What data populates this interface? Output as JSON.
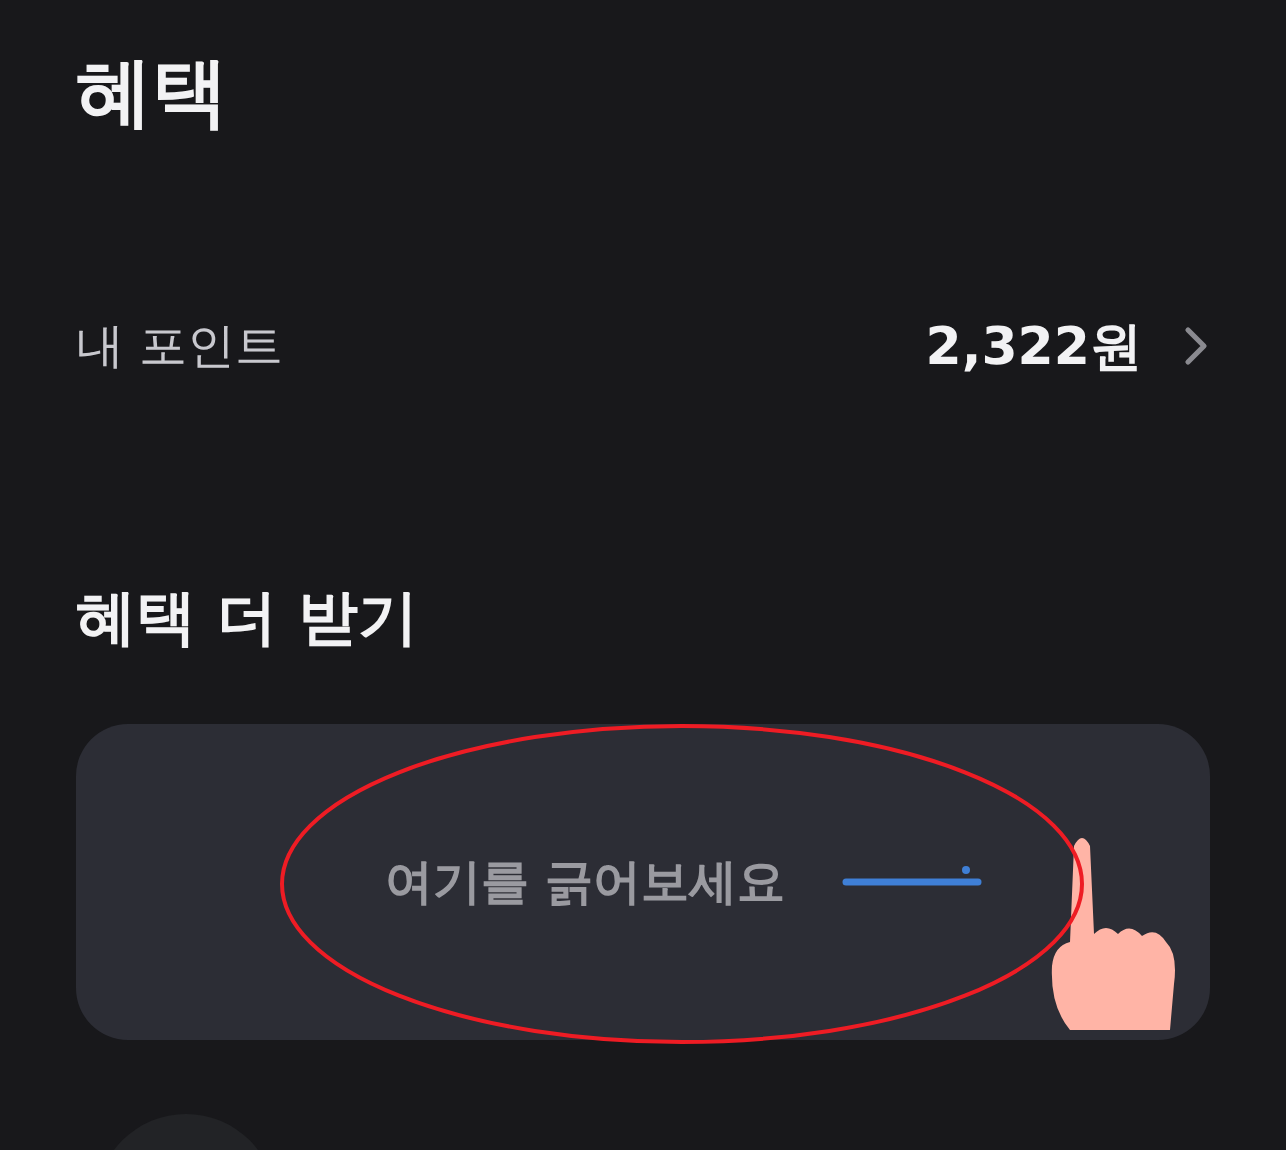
{
  "title": "혜택",
  "points": {
    "label": "내 포인트",
    "value": "2,322원"
  },
  "section": {
    "title": "혜택 더 받기"
  },
  "scratch_card": {
    "hint": "여기를 긁어보세요"
  }
}
